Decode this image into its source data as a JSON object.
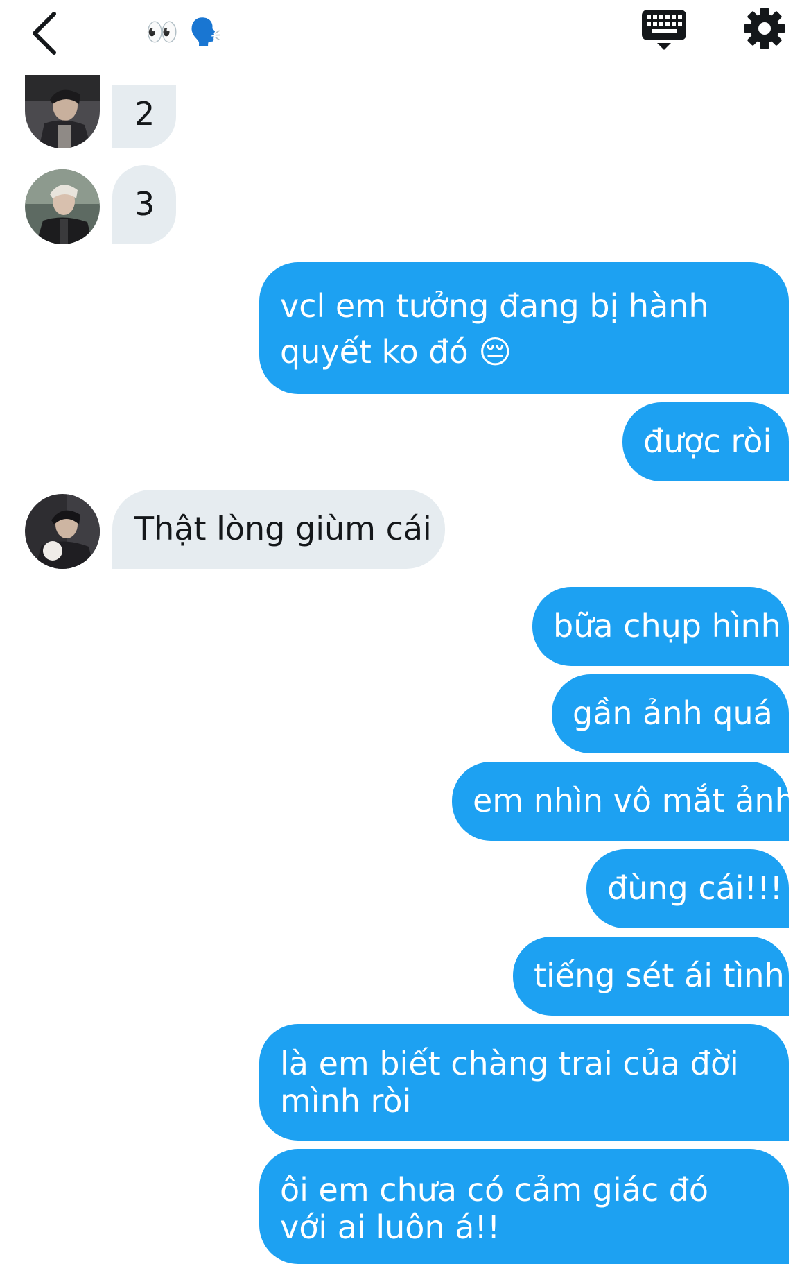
{
  "header": {
    "title_emoji": "👀 🗣️",
    "back_icon": "chevron-left-icon",
    "keyboard_icon": "keyboard-icon",
    "settings_icon": "gear-icon"
  },
  "colors": {
    "outgoing_bubble": "#1da1f2",
    "incoming_bubble": "#e6ecf0",
    "incoming_text": "#14171a",
    "outgoing_text": "#ffffff"
  },
  "messages": [
    {
      "direction": "in",
      "text": "2"
    },
    {
      "direction": "in",
      "text": "3"
    },
    {
      "direction": "out",
      "text": "vcl em tưởng đang bị hành quyết ko đó 😔"
    },
    {
      "direction": "out",
      "text": "được ròi"
    },
    {
      "direction": "in",
      "text": "Thật lòng giùm cái"
    },
    {
      "direction": "out",
      "text": "bữa chụp hình"
    },
    {
      "direction": "out",
      "text": "gần ảnh quá"
    },
    {
      "direction": "out",
      "text": "em nhìn vô mắt ảnh"
    },
    {
      "direction": "out",
      "text": "đùng cái!!!"
    },
    {
      "direction": "out",
      "text": "tiếng sét ái tình"
    },
    {
      "direction": "out",
      "text": "là em biết chàng trai của đời mình ròi"
    },
    {
      "direction": "out",
      "text": "ôi em chưa có cảm giác đó với ai luôn á!!"
    }
  ]
}
